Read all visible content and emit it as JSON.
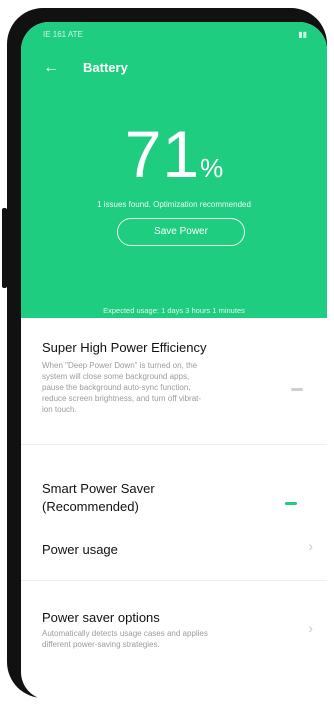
{
  "status": {
    "left": "IE 161 ATE",
    "right": "▮▮"
  },
  "header": {
    "title": "Battery",
    "back_icon": "back-arrow-icon"
  },
  "battery": {
    "value": "71",
    "unit": "%",
    "issues_text": "1 issues found. Optimization recommended",
    "save_label": "Save Power",
    "expected_text": "Expected usage: 1 days 3 hours 1 minutes"
  },
  "settings": {
    "super_high": {
      "title": "Super High Power Efficiency",
      "description_lines": [
        "When \"Deep Power Down\" is turned on, the",
        "system will close some background apps,",
        "pause the background auto-sync function,",
        "reduce screen brightness, and turn off vibrat-",
        "ion touch."
      ],
      "toggle_on": false
    },
    "smart_saver": {
      "title_line1": "Smart Power Saver",
      "title_line2": "(Recommended)",
      "toggle_on": true
    },
    "power_usage": {
      "title": "Power usage"
    },
    "saver_options": {
      "title": "Power saver options",
      "description_lines": [
        "Automatically detects usage cases and applies",
        "different power-saving strategies."
      ]
    }
  },
  "colors": {
    "accent": "#1fcd80",
    "toggle_off": "#cfcfcf"
  }
}
